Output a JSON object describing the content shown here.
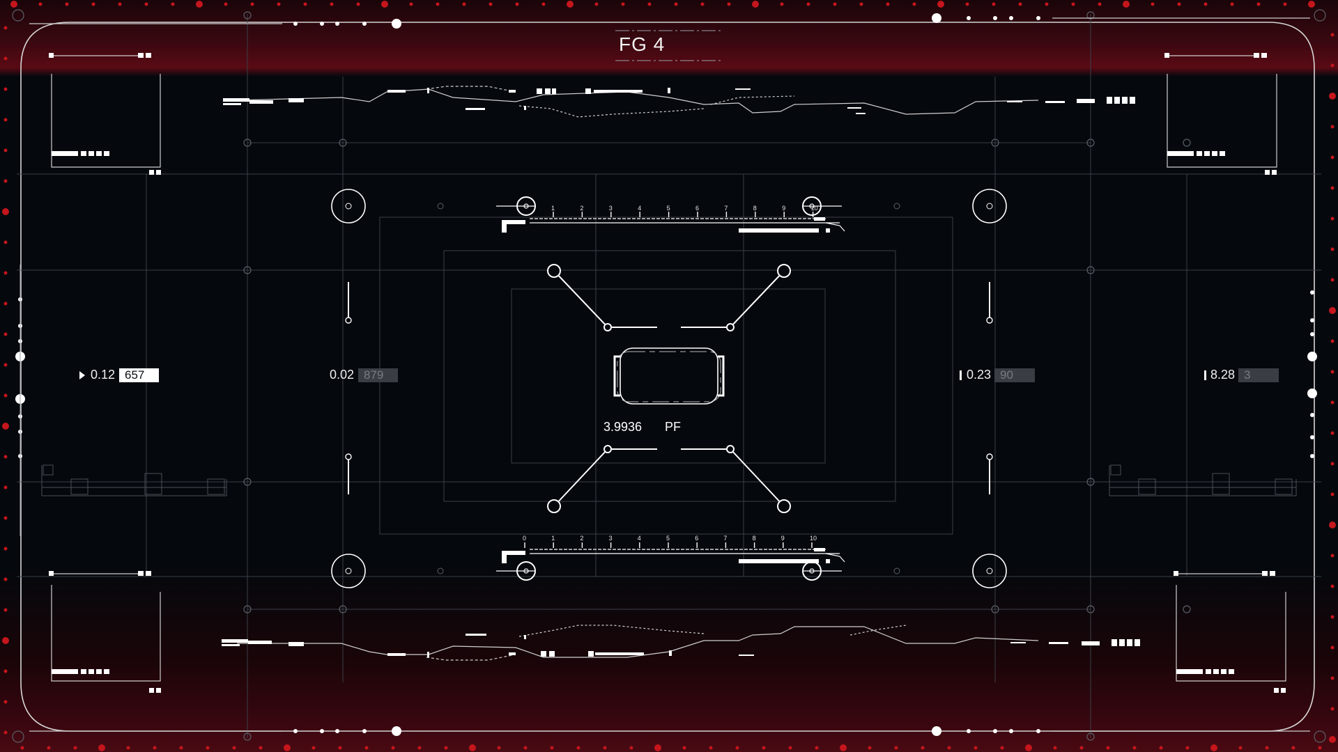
{
  "title": "FG 4",
  "readouts": [
    {
      "id": "left-outer",
      "label": "0.12",
      "value": "657",
      "style": "solid"
    },
    {
      "id": "left-inner",
      "label": "0.02",
      "value": "879",
      "style": "muted"
    },
    {
      "id": "right-inner",
      "label": "0.23",
      "value": "90",
      "style": "muted"
    },
    {
      "id": "right-outer",
      "label": "8.28",
      "value": "3",
      "style": "muted"
    }
  ],
  "center": {
    "value": "3.9936",
    "unit": "PF"
  },
  "ruler_top": [
    "1",
    "2",
    "3",
    "4",
    "5",
    "6",
    "7",
    "8",
    "9",
    "10"
  ],
  "ruler_bottom": [
    "0",
    "1",
    "2",
    "3",
    "4",
    "5",
    "6",
    "7",
    "8",
    "9",
    "10"
  ],
  "colors": {
    "accent": "#c4161c",
    "line": "#8a8f96",
    "bright": "#ffffff",
    "background": "#05080d"
  }
}
